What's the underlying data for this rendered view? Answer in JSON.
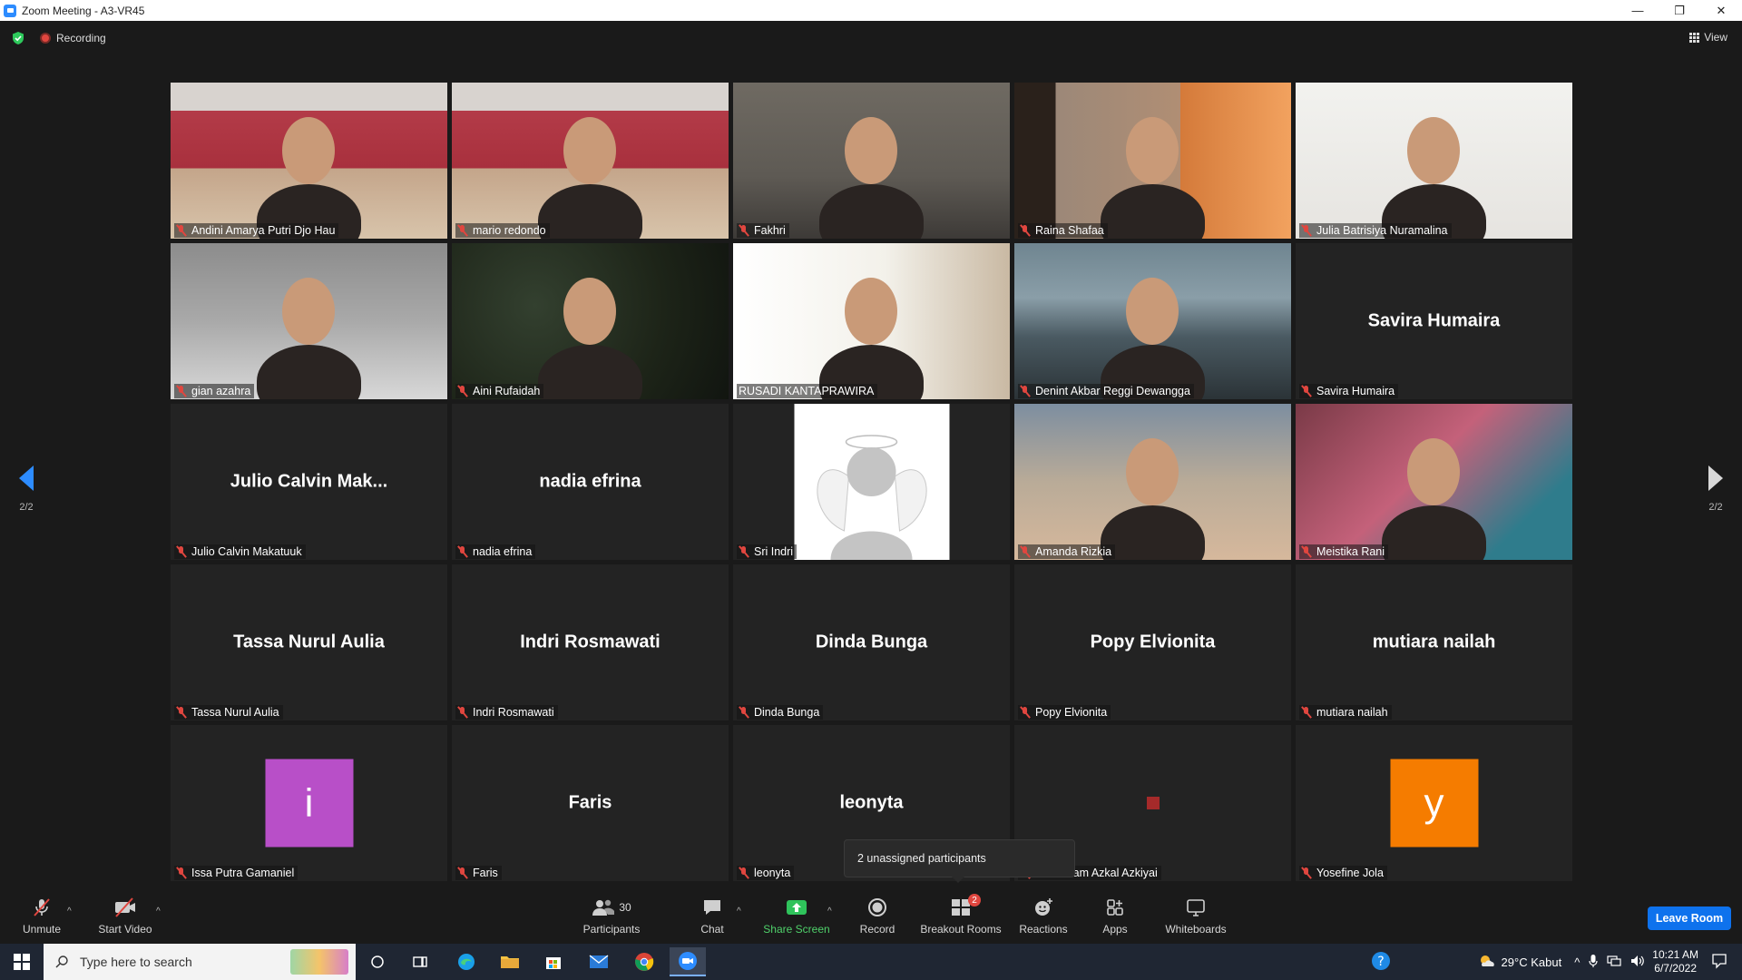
{
  "window": {
    "title": "Zoom Meeting - A3-VR45",
    "minimize": "—",
    "maximize": "❐",
    "close": "✕"
  },
  "topbar": {
    "recording": "Recording",
    "view": "View"
  },
  "pager": {
    "left": "2/2",
    "right": "2/2"
  },
  "tiles": [
    {
      "name": "Andini Amarya Putri Djo Hau",
      "type": "video",
      "bg": "v-studio"
    },
    {
      "name": "mario redondo",
      "type": "video",
      "bg": "v-studio"
    },
    {
      "name": "Fakhri",
      "type": "video",
      "bg": "v-room"
    },
    {
      "name": "Raina Shafaa",
      "type": "video",
      "bg": "v-orange"
    },
    {
      "name": "Julia Batrisiya Nuramalina",
      "type": "video",
      "bg": "v-white"
    },
    {
      "name": "gian azahra",
      "type": "video",
      "bg": "v-bedroom"
    },
    {
      "name": "Aini Rufaidah",
      "type": "video",
      "bg": "v-leaves"
    },
    {
      "name": "RUSADI KANTAPRAWIRA",
      "type": "video",
      "bg": "v-bright",
      "active": true
    },
    {
      "name": "Denint Akbar Reggi Dewangga",
      "type": "video",
      "bg": "v-jets"
    },
    {
      "name": "Savira Humaira",
      "type": "name",
      "display": "Savira Humaira"
    },
    {
      "name": "Julio Calvin Makatuuk",
      "type": "name",
      "display": "Julio Calvin Mak..."
    },
    {
      "name": "nadia efrina",
      "type": "name",
      "display": "nadia efrina"
    },
    {
      "name": "Sri Indri",
      "type": "angel"
    },
    {
      "name": "Amanda Rizkia",
      "type": "video",
      "bg": "v-car"
    },
    {
      "name": "Meistika Rani",
      "type": "video",
      "bg": "v-pink"
    },
    {
      "name": "Tassa Nurul Aulia",
      "type": "name",
      "display": "Tassa Nurul Aulia"
    },
    {
      "name": "Indri Rosmawati",
      "type": "name",
      "display": "Indri Rosmawati"
    },
    {
      "name": "Dinda Bunga",
      "type": "name",
      "display": "Dinda Bunga"
    },
    {
      "name": "Popy Elvionita",
      "type": "name",
      "display": "Popy Elvionita"
    },
    {
      "name": "mutiara nailah",
      "type": "name",
      "display": "mutiara nailah"
    },
    {
      "name": "Issa Putra Gamaniel",
      "type": "letter",
      "letter": "i",
      "color": "#b84fc8"
    },
    {
      "name": "Faris",
      "type": "name",
      "display": "Faris"
    },
    {
      "name": "leonyta",
      "type": "name",
      "display": "leonyta"
    },
    {
      "name": "Mas Adam Azkal Azkiyai",
      "type": "square"
    },
    {
      "name": "Yosefine Jola",
      "type": "letter",
      "letter": "y",
      "color": "#f57c00"
    }
  ],
  "popup": {
    "text": "2 unassigned participants"
  },
  "toolbar": {
    "unmute": "Unmute",
    "start_video": "Start Video",
    "participants": "Participants",
    "participants_count": "30",
    "chat": "Chat",
    "share_screen": "Share Screen",
    "record": "Record",
    "breakout_rooms": "Breakout Rooms",
    "breakout_badge": "2",
    "reactions": "Reactions",
    "apps": "Apps",
    "whiteboards": "Whiteboards",
    "leave": "Leave Room"
  },
  "taskbar": {
    "search_placeholder": "Type here to search",
    "weather": "29°C  Kabut",
    "time": "10:21 AM",
    "date": "6/7/2022"
  },
  "colors": {
    "accent": "#0e72ed",
    "active_speaker": "#c8e35a",
    "mute": "#e0463f"
  }
}
